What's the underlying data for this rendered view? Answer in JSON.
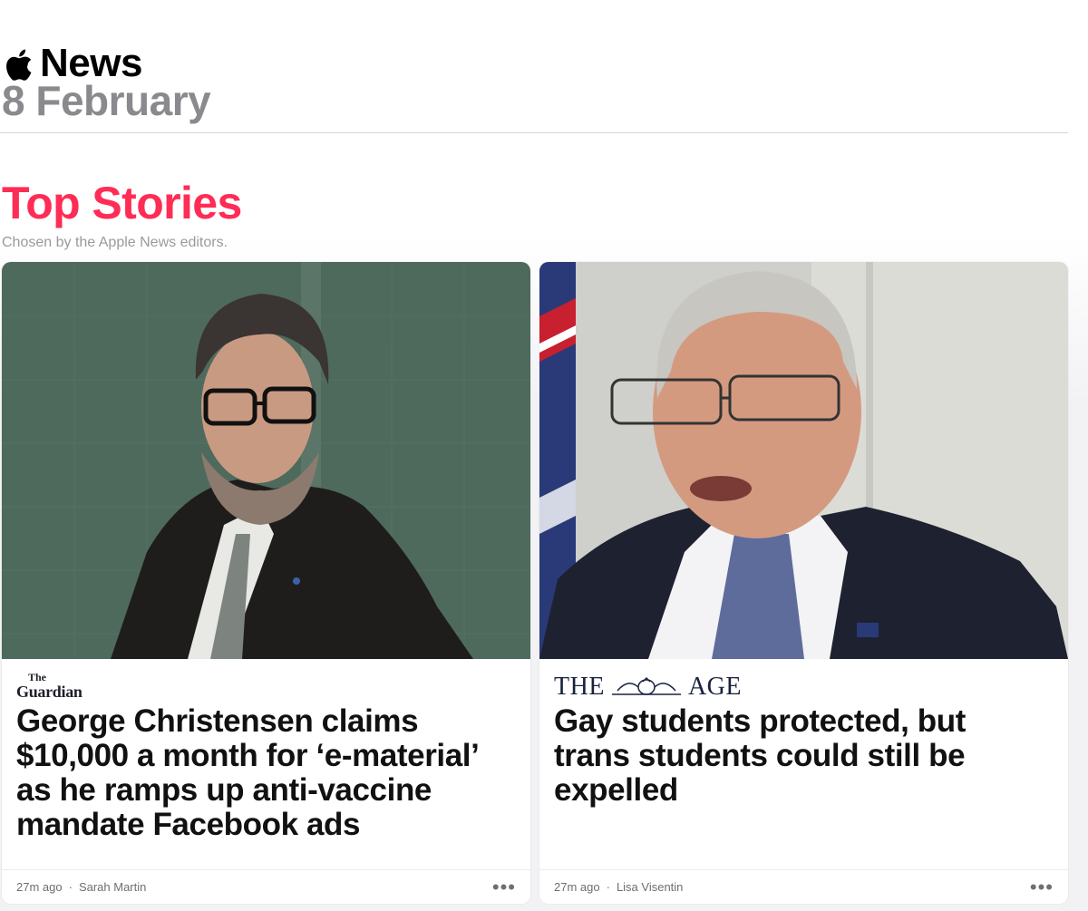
{
  "app": {
    "name": "News",
    "date": "8 February"
  },
  "section": {
    "title": "Top Stories",
    "subtitle": "Chosen by the Apple News editors."
  },
  "cards": [
    {
      "publisher_top": "The",
      "publisher_name": "Guardian",
      "headline": "George Christensen claims $10,000 a month for ‘e-material’ as he ramps up anti-vaccine mandate Facebook ads",
      "time": "27m ago",
      "author": "Sarah Martin",
      "more": "•••"
    },
    {
      "publisher_left": "THE",
      "publisher_right": "AGE",
      "headline": "Gay students protected, but trans students could still be expelled",
      "time": "27m ago",
      "author": "Lisa Visentin",
      "more": "•••"
    }
  ],
  "colors": {
    "accent": "#ff2c55",
    "date_gray": "#8a8a8e",
    "background": "#f2f2f5"
  }
}
